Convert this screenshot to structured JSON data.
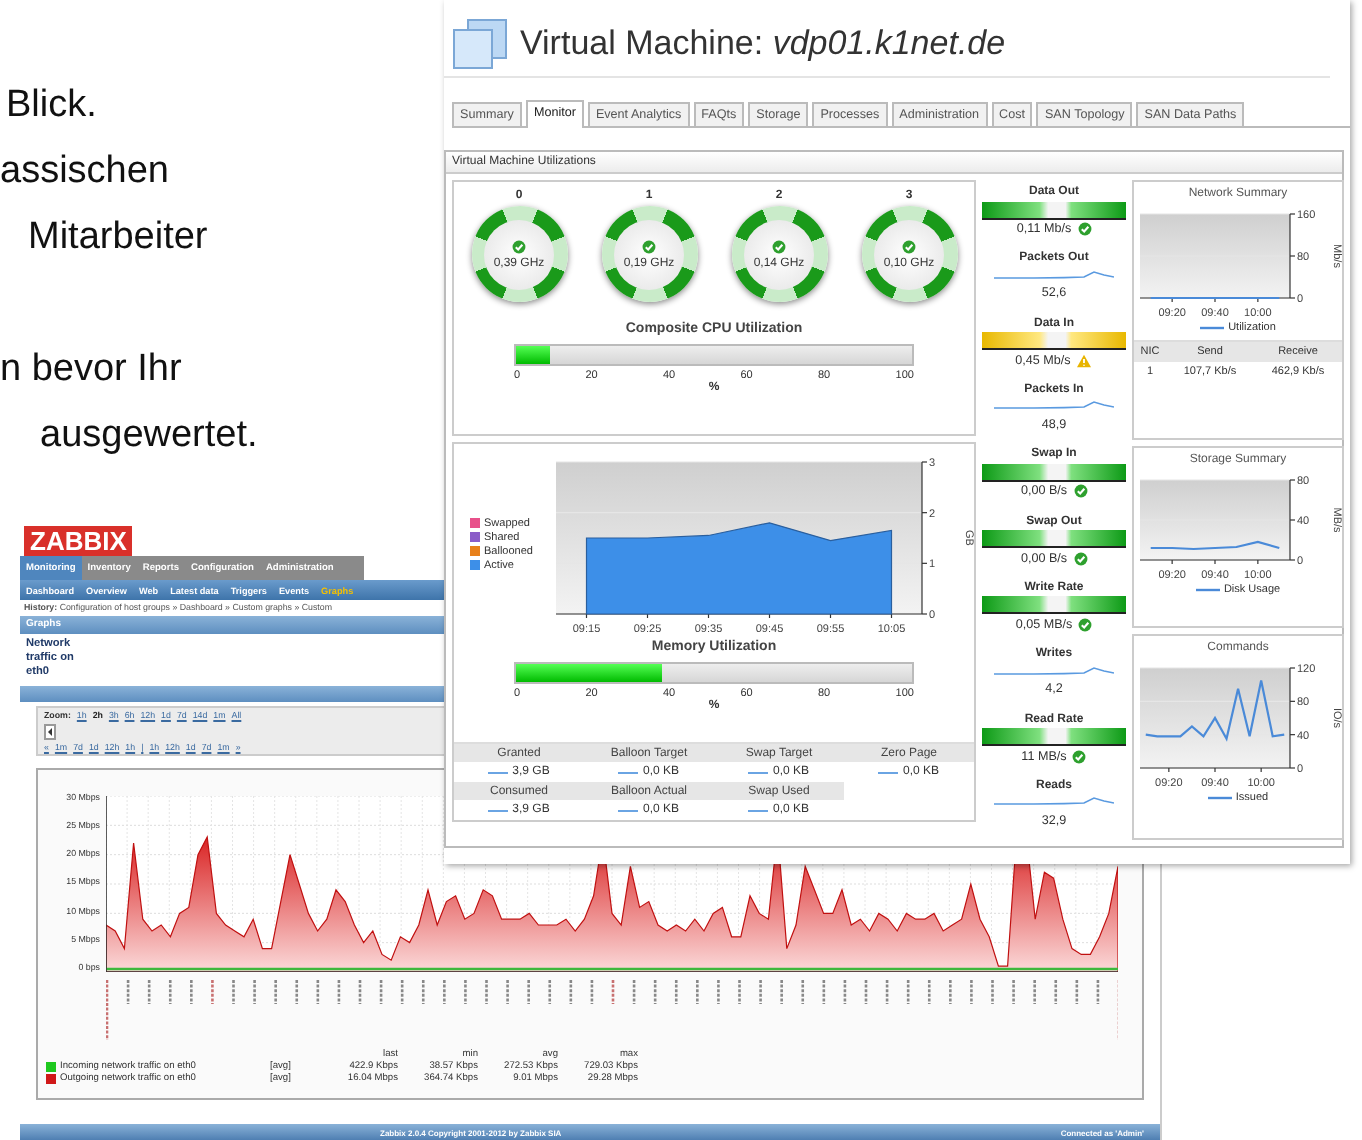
{
  "slide_text": {
    "paragraphs": [
      [
        "Blick.",
        "assischen",
        "Mitarbeiter"
      ],
      [
        "n bevor Ihr",
        "ausgewertet."
      ]
    ]
  },
  "vm_window": {
    "title": "Virtual Machine: *vdp01.k1net.de*",
    "tabs": [
      {
        "label": "Summary",
        "selected": false
      },
      {
        "label": "Monitor",
        "selected": true
      },
      {
        "label": "Event Analytics",
        "selected": false
      },
      {
        "label": "FAQts",
        "selected": false
      },
      {
        "label": "Storage",
        "selected": false
      },
      {
        "label": "Processes",
        "selected": false
      },
      {
        "label": "Administration",
        "selected": false
      },
      {
        "label": "Cost",
        "selected": false
      },
      {
        "label": "SAN Topology",
        "selected": false
      },
      {
        "label": "SAN Data Paths",
        "selected": false
      }
    ],
    "panel_title": "Virtual Machine Utilizations",
    "cpu": {
      "cores": [
        {
          "label": "0",
          "reading": "0,39 GHz",
          "warning": false
        },
        {
          "label": "1",
          "reading": "0,19 GHz",
          "warning": false
        },
        {
          "label": "2",
          "reading": "0,14 GHz",
          "warning": false
        },
        {
          "label": "3",
          "reading": "0,10 GHz",
          "warning": false
        }
      ],
      "title": "Composite CPU Utilization",
      "level": 0.085,
      "ticks": [
        "0",
        "20",
        "40",
        "60",
        "80",
        "100"
      ],
      "unit": "%"
    },
    "memory": {
      "chart_data": {
        "type": "area",
        "ylabel": "GB",
        "categories": [
          "09:15",
          "09:25",
          "09:35",
          "09:45",
          "09:55",
          "10:05"
        ],
        "ylim": [
          0,
          3
        ],
        "yticks": [
          0,
          1,
          2,
          3
        ],
        "series": [
          {
            "name": "Swapped",
            "color": "#e8508a",
            "values": [
              null,
              null,
              null,
              null,
              null,
              null
            ]
          },
          {
            "name": "Shared",
            "color": "#8a5cc8",
            "values": [
              null,
              null,
              null,
              null,
              null,
              null
            ]
          },
          {
            "name": "Ballooned",
            "color": "#e8801a",
            "values": [
              null,
              null,
              null,
              null,
              null,
              null
            ]
          },
          {
            "name": "Active",
            "color": "#3d8fe8",
            "values": [
              1.5,
              1.5,
              1.55,
              1.8,
              1.45,
              1.65
            ]
          }
        ]
      },
      "title": "Memory Utilization",
      "level": 0.37,
      "ticks": [
        "0",
        "20",
        "40",
        "60",
        "80",
        "100"
      ],
      "unit": "%",
      "stats": [
        {
          "label": "Granted",
          "value": "3,9 GB"
        },
        {
          "label": "Balloon Target",
          "value": "0,0 KB"
        },
        {
          "label": "Swap Target",
          "value": "0,0 KB"
        },
        {
          "label": "Zero Page",
          "value": "0,0 KB"
        },
        {
          "label": "Consumed",
          "value": "3,9 GB"
        },
        {
          "label": "Balloon Actual",
          "value": "0,0 KB"
        },
        {
          "label": "Swap Used",
          "value": "0,0 KB"
        }
      ]
    },
    "metrics": [
      {
        "kind": "gauge",
        "label": "Data Out",
        "reading": "0,11 Mb/s",
        "warning": false
      },
      {
        "kind": "spark",
        "label": "Packets Out",
        "reading": "52,6"
      },
      {
        "kind": "gauge",
        "label": "Data In",
        "reading": "0,45 Mb/s",
        "warning": true
      },
      {
        "kind": "spark",
        "label": "Packets In",
        "reading": "48,9"
      },
      {
        "kind": "gauge",
        "label": "Swap In",
        "reading": "0,00 B/s",
        "warning": false
      },
      {
        "kind": "gauge",
        "label": "Swap Out",
        "reading": "0,00 B/s",
        "warning": false
      },
      {
        "kind": "gauge",
        "label": "Write Rate",
        "reading": "0,05 MB/s",
        "warning": false
      },
      {
        "kind": "spark",
        "label": "Writes",
        "reading": "4,2"
      },
      {
        "kind": "gauge",
        "label": "Read Rate",
        "reading": "11 MB/s",
        "warning": false
      },
      {
        "kind": "spark",
        "label": "Reads",
        "reading": "32,9"
      }
    ],
    "network_summary": {
      "title": "Network Summary",
      "chart_data": {
        "type": "line",
        "ylabel": "Mb/s",
        "categories": [
          null,
          "09:20",
          null,
          "09:40",
          null,
          "10:00",
          null
        ],
        "ylim": [
          0,
          160
        ],
        "yticks": [
          0,
          80,
          160
        ],
        "series": [
          {
            "name": "Utilization",
            "color": "#4a8ad8",
            "values": [
              0,
              0,
              0,
              0,
              0,
              0,
              0
            ]
          }
        ]
      },
      "nic_table": {
        "columns": [
          "NIC",
          "Send",
          "Receive"
        ],
        "rows": [
          [
            "1",
            "107,7 Kb/s",
            "462,9 Kb/s"
          ]
        ]
      }
    },
    "storage_summary": {
      "title": "Storage Summary",
      "chart_data": {
        "type": "line",
        "ylabel": "MB/s",
        "categories": [
          null,
          "09:20",
          null,
          "09:40",
          null,
          "10:00",
          null
        ],
        "ylim": [
          0,
          80
        ],
        "yticks": [
          0,
          40,
          80
        ],
        "series": [
          {
            "name": "Disk Usage",
            "color": "#4a8ad8",
            "values": [
              12,
              12,
              11,
              12,
              13,
              18,
              12
            ]
          }
        ]
      }
    },
    "commands": {
      "title": "Commands",
      "chart_data": {
        "type": "line",
        "ylabel": "IO/s",
        "categories": [
          null,
          null,
          "09:20",
          null,
          null,
          null,
          "09:40",
          null,
          null,
          null,
          "10:00",
          null,
          null
        ],
        "ylim": [
          0,
          120
        ],
        "yticks": [
          0,
          40,
          80,
          120
        ],
        "series": [
          {
            "name": "Issued",
            "color": "#4a8ad8",
            "values": [
              40,
              38,
              38,
              38,
              50,
              38,
              60,
              35,
              95,
              38,
              105,
              38,
              40
            ]
          }
        ]
      }
    }
  },
  "zabbix_window": {
    "logo": "ZABBIX",
    "menu": [
      {
        "label": "Monitoring",
        "selected": true
      },
      {
        "label": "Inventory",
        "selected": false
      },
      {
        "label": "Reports",
        "selected": false
      },
      {
        "label": "Configuration",
        "selected": false
      },
      {
        "label": "Administration",
        "selected": false
      }
    ],
    "submenu": [
      {
        "label": "Dashboard",
        "selected": false
      },
      {
        "label": "Overview",
        "selected": false
      },
      {
        "label": "Web",
        "selected": false
      },
      {
        "label": "Latest data",
        "selected": false
      },
      {
        "label": "Triggers",
        "selected": false
      },
      {
        "label": "Events",
        "selected": false
      },
      {
        "label": "Graphs",
        "selected": true
      }
    ],
    "history": "**History:** Configuration of host groups » Dashboard » Custom graphs » Custom",
    "section_title": "Graphs",
    "graph_name": "Network traffic on eth0",
    "zoom_label": "Zoom:",
    "zoom_links": [
      {
        "label": "1h",
        "selected": false
      },
      {
        "label": "2h",
        "selected": true
      },
      {
        "label": "3h",
        "selected": false
      },
      {
        "label": "6h",
        "selected": false
      },
      {
        "label": "12h",
        "selected": false
      },
      {
        "label": "1d",
        "selected": false
      },
      {
        "label": "7d",
        "selected": false
      },
      {
        "label": "14d",
        "selected": false
      },
      {
        "label": "1m",
        "selected": false
      },
      {
        "label": "All",
        "selected": false
      }
    ],
    "nav_links": [
      "«",
      "1m",
      "7d",
      "1d",
      "12h",
      "1h",
      "|",
      "1h",
      "12h",
      "1d",
      "7d",
      "1m",
      "»"
    ],
    "chart": {
      "y_labels": [
        "30 Mbps",
        "25 Mbps",
        "20 Mbps",
        "15 Mbps",
        "10 Mbps",
        "5 Mbps",
        "0 bps"
      ],
      "legend": {
        "columns": [
          "last",
          "min",
          "avg",
          "max"
        ],
        "rows": [
          {
            "name": "Incoming network traffic on eth0",
            "color": "#1ec81e",
            "function": "[avg]",
            "values": [
              "422.9 Kbps",
              "38.57 Kbps",
              "272.53 Kbps",
              "729.03 Kbps"
            ]
          },
          {
            "name": "Outgoing network traffic on eth0",
            "color": "#d01818",
            "function": "[avg]",
            "values": [
              "16.04 Mbps",
              "364.74 Kbps",
              "9.01 Mbps",
              "29.28 Mbps"
            ]
          }
        ]
      }
    },
    "footer_left": "Zabbix 2.0.4 Copyright 2001-2012 by Zabbix SIA",
    "footer_right": "Connected as 'Admin'"
  }
}
